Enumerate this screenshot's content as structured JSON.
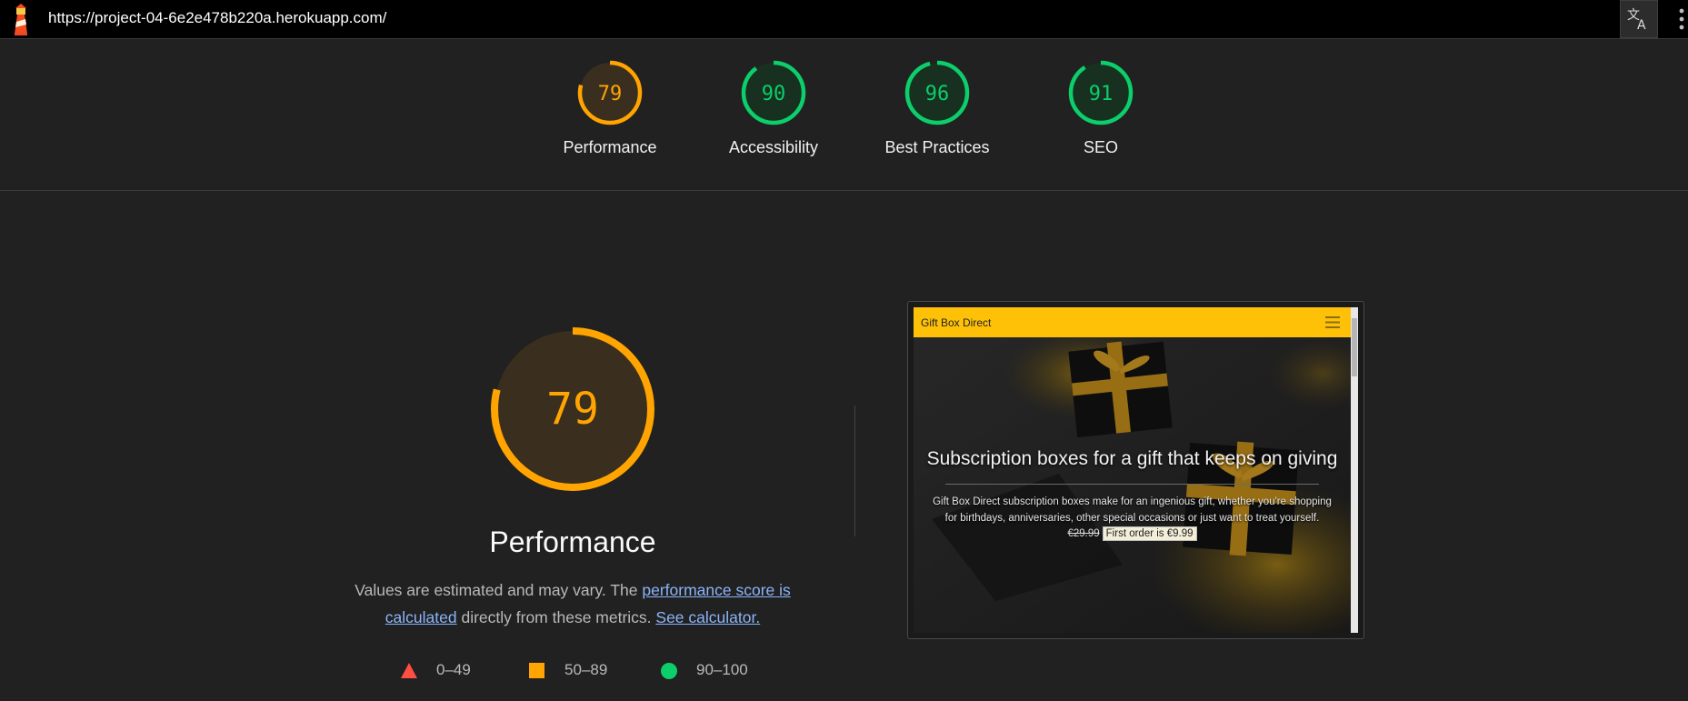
{
  "browser": {
    "url": "https://project-04-6e2e478b220a.herokuapp.com/"
  },
  "summary_gauges": [
    {
      "label": "Performance",
      "score": "79",
      "color": "#ffa400"
    },
    {
      "label": "Accessibility",
      "score": "90",
      "color": "#0cce6b"
    },
    {
      "label": "Best Practices",
      "score": "96",
      "color": "#0cce6b"
    },
    {
      "label": "SEO",
      "score": "91",
      "color": "#0cce6b"
    }
  ],
  "performance": {
    "score": "79",
    "title": "Performance",
    "desc_prefix": "Values are estimated and may vary. The ",
    "desc_link1": "performance score is calculated",
    "desc_middle": " directly from these metrics. ",
    "desc_link2": "See calculator.",
    "color": "#ffa400"
  },
  "legend": [
    {
      "range": "0–49",
      "shape": "triangle",
      "color": "#ff4e42"
    },
    {
      "range": "50–89",
      "shape": "square",
      "color": "#ffa400"
    },
    {
      "range": "90–100",
      "shape": "circle",
      "color": "#0cce6b"
    }
  ],
  "preview": {
    "brand": "Gift Box Direct",
    "hero_title": "Subscription boxes for a gift that keeps on giving",
    "hero_text_line1": "Gift Box Direct subscription boxes make for an ingenious gift, whether you're shopping",
    "hero_text_line2": "for birthdays, anniversaries, other special occasions or just want to treat yourself.",
    "old_price": "€29.99",
    "offer": "First order is €9.99",
    "nav_color": "#ffc107"
  }
}
